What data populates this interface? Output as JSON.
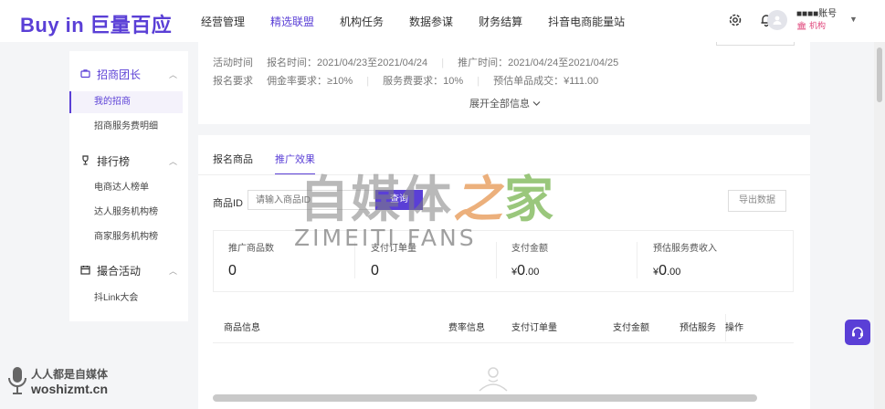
{
  "brand": {
    "logo_en": "Buy in",
    "logo_cn": "巨量百应",
    "accent": "#5a3fd6"
  },
  "nav": {
    "items": [
      {
        "label": "经营管理"
      },
      {
        "label": "精选联盟"
      },
      {
        "label": "机构任务"
      },
      {
        "label": "数据参谋"
      },
      {
        "label": "财务结算"
      },
      {
        "label": "抖音电商能量站"
      }
    ],
    "active_index": 1
  },
  "account": {
    "name": "■■■■账号",
    "tag": "机构"
  },
  "sidebar": {
    "groups": [
      {
        "label": "招商团长",
        "icon": "briefcase-icon",
        "items": [
          "我的招商",
          "招商服务费明细"
        ]
      },
      {
        "label": "排行榜",
        "icon": "trophy-icon",
        "items": [
          "电商达人榜单",
          "达人服务机构榜",
          "商家服务机构榜"
        ]
      },
      {
        "label": "撮合活动",
        "icon": "calendar-icon",
        "items": [
          "抖Link大会"
        ]
      }
    ],
    "active_item": "我的招商"
  },
  "info": {
    "row1": {
      "activity_time": "活动时间",
      "signup_time": "报名时间：2021/04/23至2021/04/24",
      "promo_time": "推广时间：2021/04/24至2021/04/25"
    },
    "row2": {
      "requirement": "报名要求",
      "commission": "佣金率要求：≥10%",
      "service_fee": "服务费要求：10%",
      "estimated": "预估单品成交：¥111.00"
    },
    "expand_label": "展开全部信息"
  },
  "tabs": [
    {
      "label": "报名商品"
    },
    {
      "label": "推广效果"
    }
  ],
  "active_tab": 1,
  "query": {
    "label": "商品ID",
    "placeholder": "请输入商品ID",
    "button": "查询",
    "export": "导出数据"
  },
  "stats": [
    {
      "label": "推广商品数",
      "value": "0"
    },
    {
      "label": "支付订单量",
      "value": "0"
    },
    {
      "label": "支付金额",
      "currency": "¥",
      "value": "0",
      "decimals": ".00"
    },
    {
      "label": "预估服务费收入",
      "currency": "¥",
      "value": "0",
      "decimals": ".00"
    }
  ],
  "table": {
    "columns": [
      "商品信息",
      "费率信息",
      "支付订单量",
      "支付金额",
      "预估服务",
      "操作"
    ]
  },
  "watermark": {
    "line1_a": "自媒体",
    "line1_b": "之",
    "line1_c": "家",
    "line2": "ZIMEITI.FANS",
    "corner1": "人人都是自媒体",
    "corner2": "woshizmt.cn"
  }
}
